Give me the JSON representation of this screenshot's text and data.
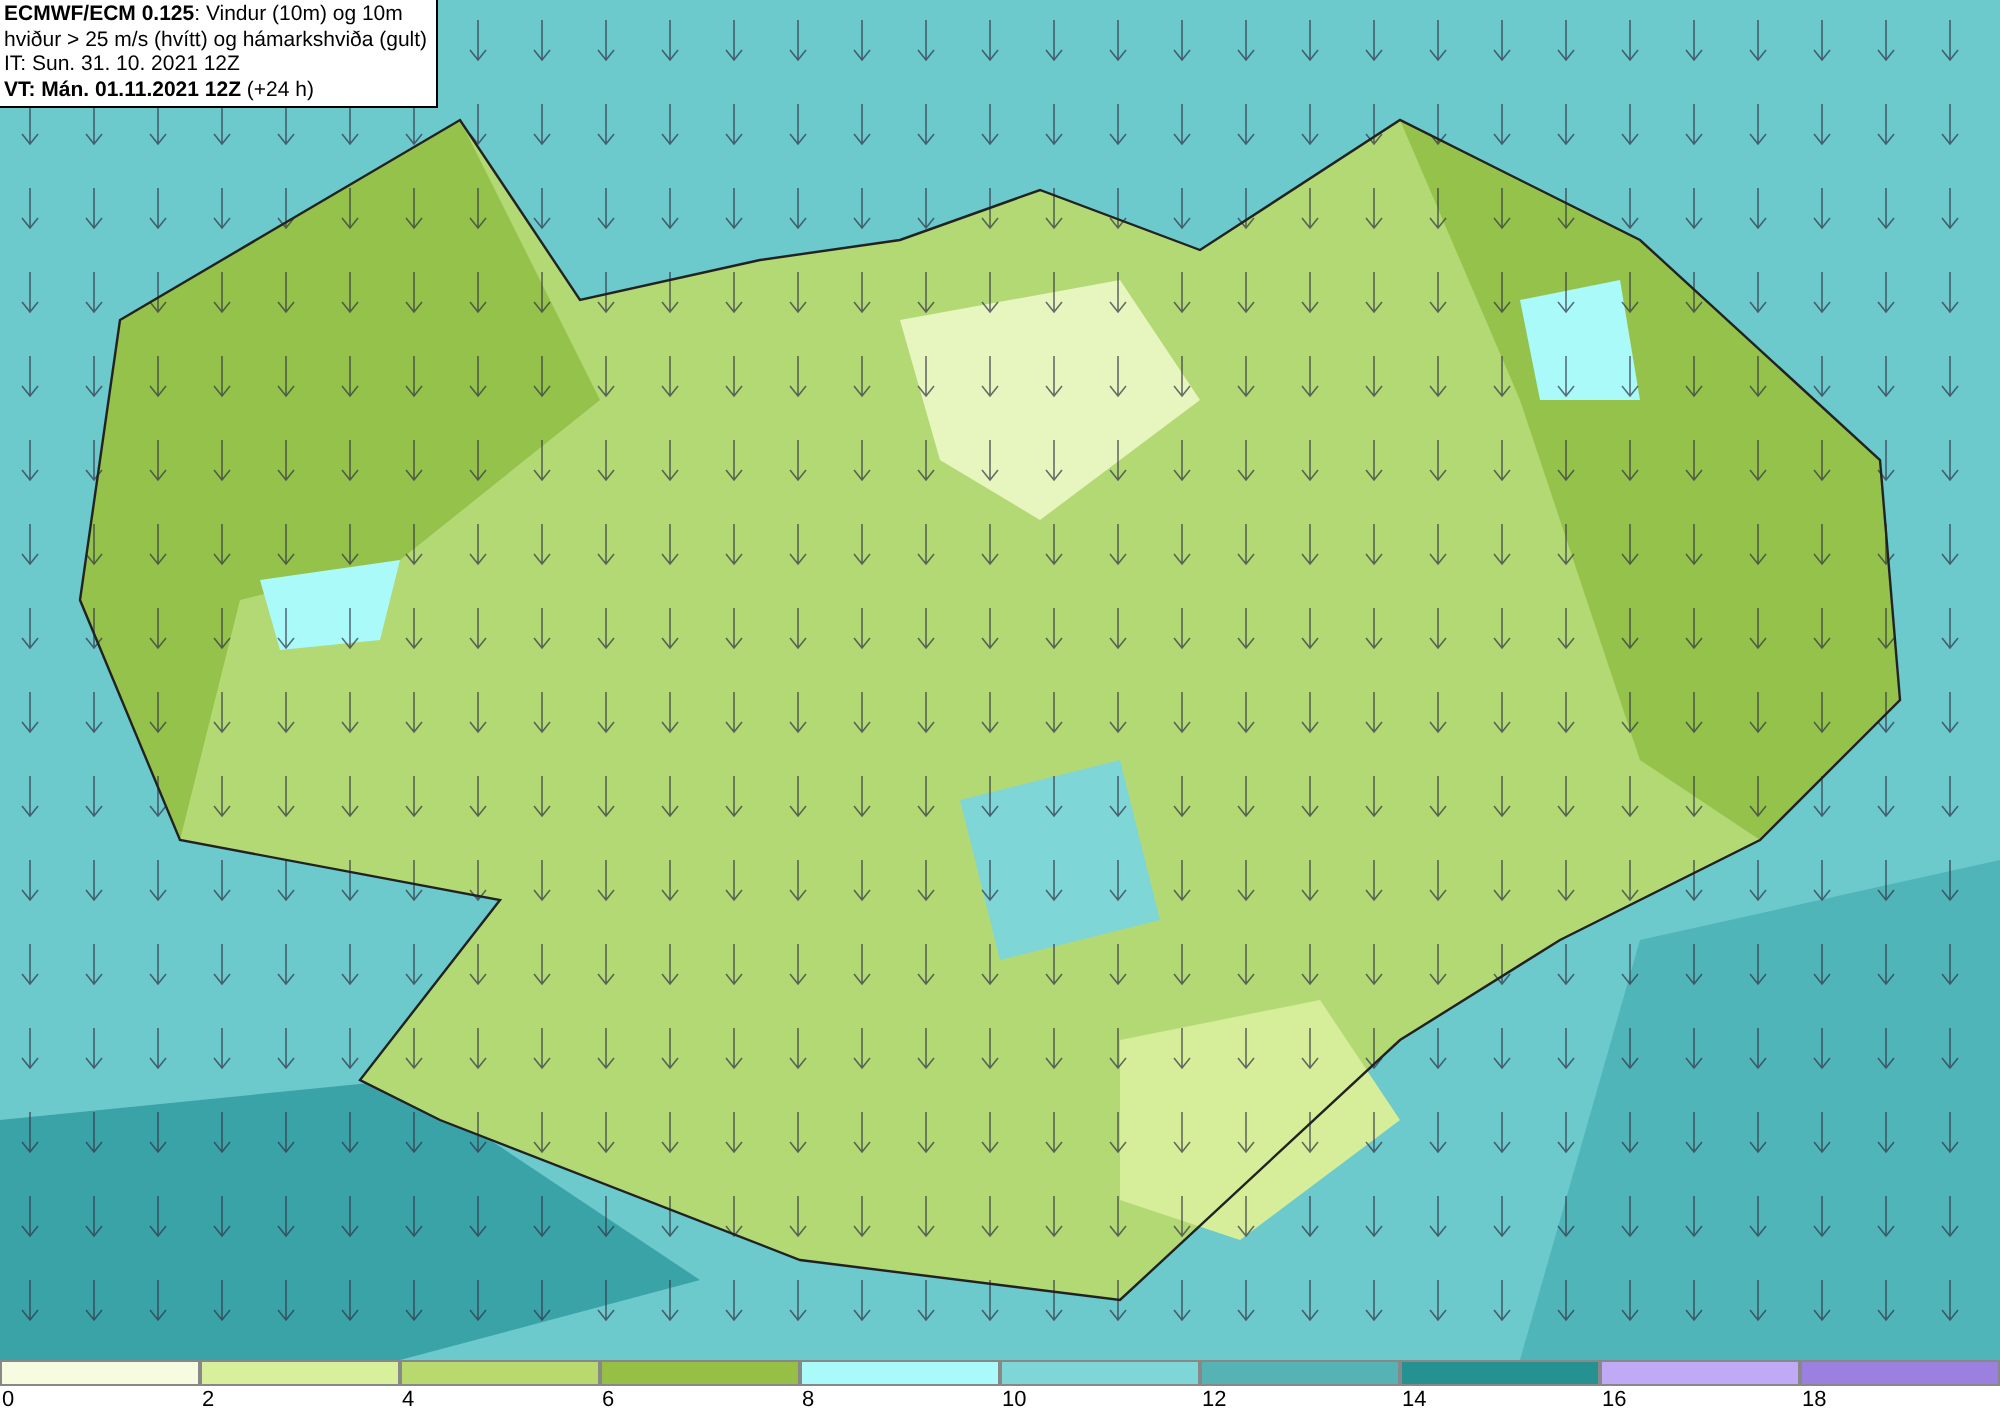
{
  "title_box": {
    "lines": [
      "**ECMWF/ECM 0.125**: Vindur (10m) og 10m",
      "hviður > 25 m/s (hvítt) og hámarkshviða (gult)",
      "IT: Sun. 31. 10. 2021 12Z",
      "**VT: Mán. 01.11.2021 12Z** (+24 h)"
    ]
  },
  "legend": [
    {
      "label": "0",
      "color": "#f7fbe0"
    },
    {
      "label": "2",
      "color": "#d8ef9c"
    },
    {
      "label": "4",
      "color": "#b8d96e"
    },
    {
      "label": "6",
      "color": "#96bf45"
    },
    {
      "label": "8",
      "color": "#aafafa"
    },
    {
      "label": "10",
      "color": "#7fd6d6"
    },
    {
      "label": "12",
      "color": "#55b3b3"
    },
    {
      "label": "14",
      "color": "#259191"
    },
    {
      "label": "16",
      "color": "#c0aaf5"
    },
    {
      "label": "18",
      "color": "#9b80e0"
    }
  ]
}
